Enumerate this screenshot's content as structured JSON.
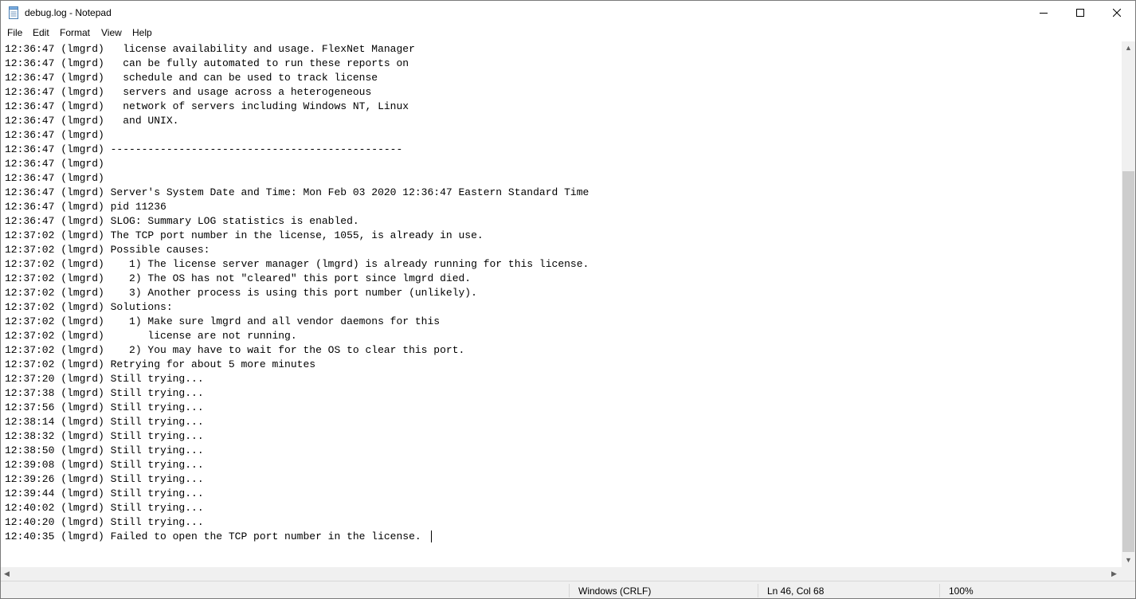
{
  "window": {
    "title": "debug.log - Notepad"
  },
  "icons": {
    "app": "notepad-icon",
    "minimize": "minimize-icon",
    "maximize": "maximize-icon",
    "close": "close-icon"
  },
  "menu": [
    "File",
    "Edit",
    "Format",
    "View",
    "Help"
  ],
  "editor": {
    "lines": [
      "12:36:47 (lmgrd)   license availability and usage. FlexNet Manager",
      "12:36:47 (lmgrd)   can be fully automated to run these reports on",
      "12:36:47 (lmgrd)   schedule and can be used to track license",
      "12:36:47 (lmgrd)   servers and usage across a heterogeneous",
      "12:36:47 (lmgrd)   network of servers including Windows NT, Linux",
      "12:36:47 (lmgrd)   and UNIX.",
      "12:36:47 (lmgrd)",
      "12:36:47 (lmgrd) -----------------------------------------------",
      "12:36:47 (lmgrd)",
      "12:36:47 (lmgrd)",
      "12:36:47 (lmgrd) Server's System Date and Time: Mon Feb 03 2020 12:36:47 Eastern Standard Time",
      "12:36:47 (lmgrd) pid 11236",
      "12:36:47 (lmgrd) SLOG: Summary LOG statistics is enabled.",
      "12:37:02 (lmgrd) The TCP port number in the license, 1055, is already in use.",
      "12:37:02 (lmgrd) Possible causes:",
      "12:37:02 (lmgrd)    1) The license server manager (lmgrd) is already running for this license.",
      "12:37:02 (lmgrd)    2) The OS has not \"cleared\" this port since lmgrd died.",
      "12:37:02 (lmgrd)    3) Another process is using this port number (unlikely).",
      "12:37:02 (lmgrd) Solutions:",
      "12:37:02 (lmgrd)    1) Make sure lmgrd and all vendor daemons for this",
      "12:37:02 (lmgrd)       license are not running.",
      "12:37:02 (lmgrd)    2) You may have to wait for the OS to clear this port.",
      "12:37:02 (lmgrd) Retrying for about 5 more minutes",
      "12:37:20 (lmgrd) Still trying...",
      "12:37:38 (lmgrd) Still trying...",
      "12:37:56 (lmgrd) Still trying...",
      "12:38:14 (lmgrd) Still trying...",
      "12:38:32 (lmgrd) Still trying...",
      "12:38:50 (lmgrd) Still trying...",
      "12:39:08 (lmgrd) Still trying...",
      "12:39:26 (lmgrd) Still trying...",
      "12:39:44 (lmgrd) Still trying...",
      "12:40:02 (lmgrd) Still trying...",
      "12:40:20 (lmgrd) Still trying...",
      "12:40:35 (lmgrd) Failed to open the TCP port number in the license."
    ]
  },
  "status": {
    "line_ending": "Windows (CRLF)",
    "position": "Ln 46, Col 68",
    "zoom": "100%"
  }
}
